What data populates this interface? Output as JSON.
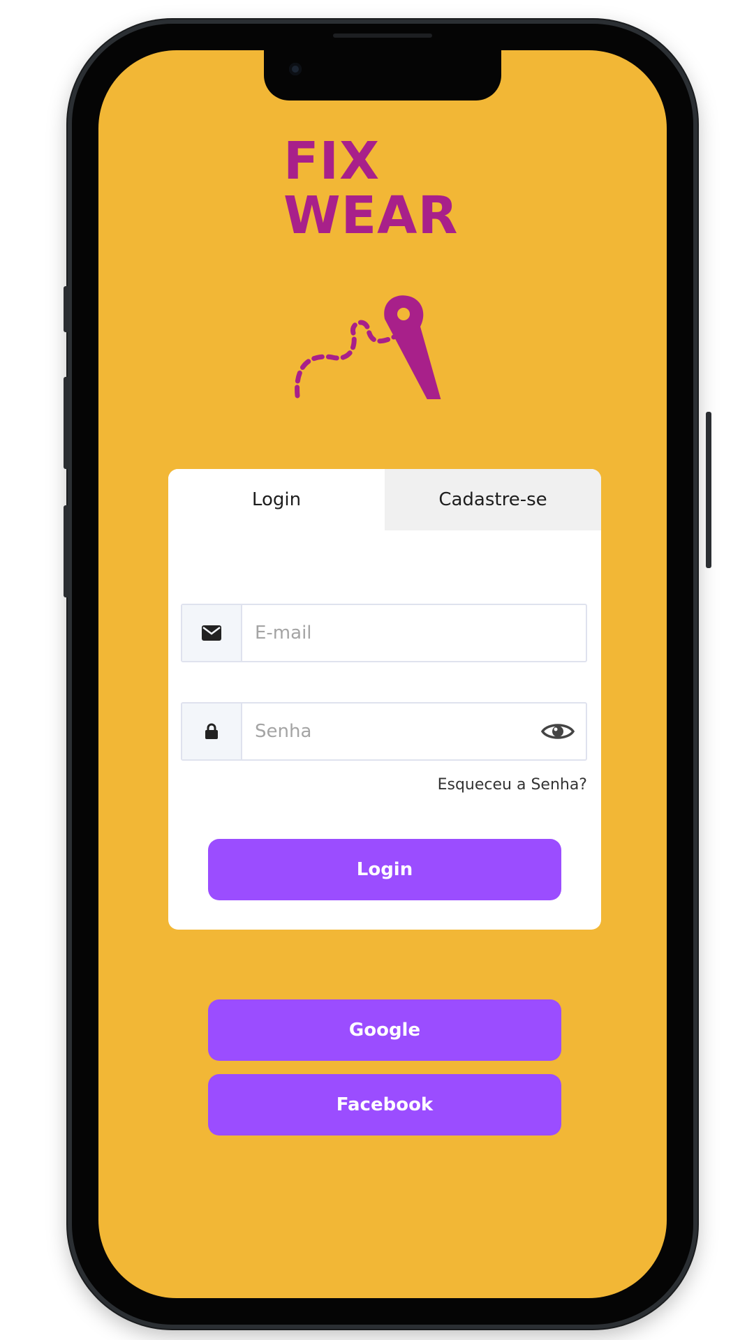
{
  "brand": {
    "logo_line1": "FIX",
    "logo_line2": "WEAR",
    "logo_color": "#a8208a"
  },
  "colors": {
    "background": "#f2b736",
    "accent": "#9b4dff",
    "card": "#ffffff",
    "inactive_tab": "#f0f0f0"
  },
  "tabs": [
    {
      "label": "Login",
      "active": true
    },
    {
      "label": "Cadastre-se",
      "active": false
    }
  ],
  "form": {
    "email": {
      "placeholder": "E-mail",
      "value": "",
      "icon": "envelope-icon"
    },
    "password": {
      "placeholder": "Senha",
      "value": "",
      "icon": "lock-icon",
      "toggle_icon": "eye-icon"
    },
    "forgot_label": "Esqueceu a Senha?",
    "submit_label": "Login"
  },
  "social": {
    "google_label": "Google",
    "facebook_label": "Facebook"
  }
}
